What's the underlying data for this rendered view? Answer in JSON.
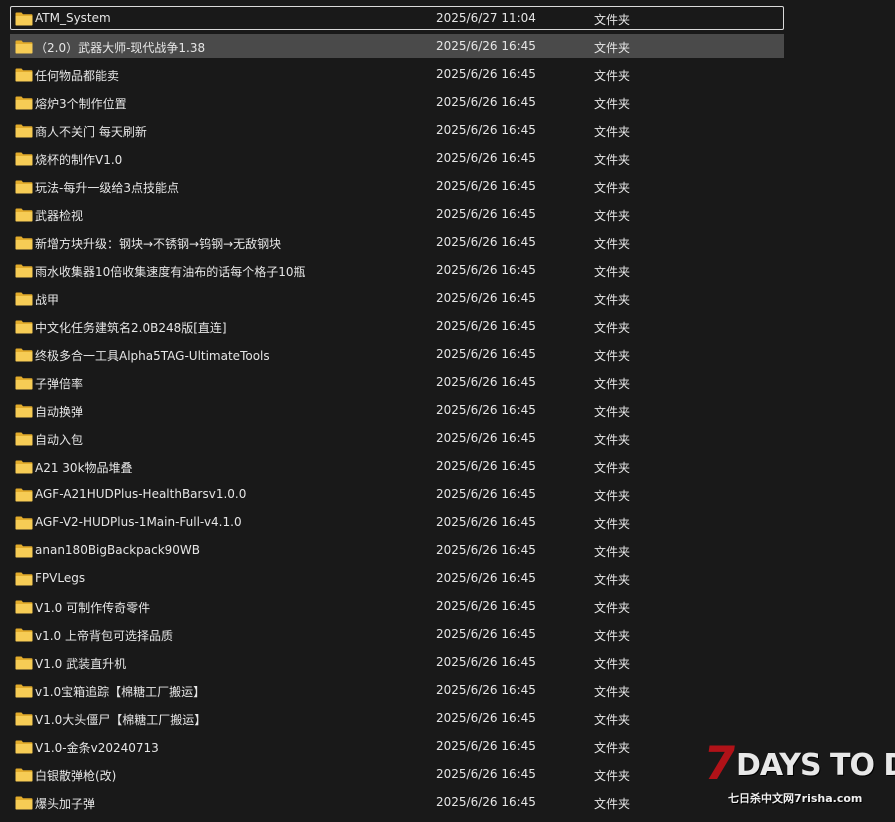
{
  "colors": {
    "background": "#191919",
    "selected_row": "#4a4a4a",
    "folder_yellow": "#f4c64a",
    "watermark_red": "#b01218"
  },
  "files": [
    {
      "name": "ATM_System",
      "date": "2025/6/27 11:04",
      "type": "文件夹",
      "icon": "folder-icon",
      "state": "focused"
    },
    {
      "name": "（2.0）武器大师-现代战争1.38",
      "date": "2025/6/26 16:45",
      "type": "文件夹",
      "icon": "folder-icon",
      "state": "selected"
    },
    {
      "name": "任何物品都能卖",
      "date": "2025/6/26 16:45",
      "type": "文件夹",
      "icon": "folder-icon",
      "state": ""
    },
    {
      "name": "熔炉3个制作位置",
      "date": "2025/6/26 16:45",
      "type": "文件夹",
      "icon": "folder-icon",
      "state": ""
    },
    {
      "name": "商人不关门 每天刷新",
      "date": "2025/6/26 16:45",
      "type": "文件夹",
      "icon": "folder-icon",
      "state": ""
    },
    {
      "name": "烧杯的制作V1.0",
      "date": "2025/6/26 16:45",
      "type": "文件夹",
      "icon": "folder-icon",
      "state": ""
    },
    {
      "name": "玩法-每升一级给3点技能点",
      "date": "2025/6/26 16:45",
      "type": "文件夹",
      "icon": "folder-icon",
      "state": ""
    },
    {
      "name": "武器检视",
      "date": "2025/6/26 16:45",
      "type": "文件夹",
      "icon": "folder-icon",
      "state": ""
    },
    {
      "name": "新增方块升级：钢块→不锈钢→钨钢→无敌钢块",
      "date": "2025/6/26 16:45",
      "type": "文件夹",
      "icon": "folder-icon",
      "state": ""
    },
    {
      "name": "雨水收集器10倍收集速度有油布的话每个格子10瓶",
      "date": "2025/6/26 16:45",
      "type": "文件夹",
      "icon": "folder-icon",
      "state": ""
    },
    {
      "name": "战甲",
      "date": "2025/6/26 16:45",
      "type": "文件夹",
      "icon": "folder-icon",
      "state": ""
    },
    {
      "name": "中文化任务建筑名2.0B248版[直连]",
      "date": "2025/6/26 16:45",
      "type": "文件夹",
      "icon": "folder-icon",
      "state": ""
    },
    {
      "name": "终极多合一工具Alpha5TAG-UltimateTools",
      "date": "2025/6/26 16:45",
      "type": "文件夹",
      "icon": "folder-icon",
      "state": ""
    },
    {
      "name": "子弹倍率",
      "date": "2025/6/26 16:45",
      "type": "文件夹",
      "icon": "folder-icon",
      "state": ""
    },
    {
      "name": "自动换弹",
      "date": "2025/6/26 16:45",
      "type": "文件夹",
      "icon": "folder-icon",
      "state": ""
    },
    {
      "name": "自动入包",
      "date": "2025/6/26 16:45",
      "type": "文件夹",
      "icon": "folder-icon",
      "state": ""
    },
    {
      "name": "A21 30k物品堆叠",
      "date": "2025/6/26 16:45",
      "type": "文件夹",
      "icon": "folder-icon",
      "state": ""
    },
    {
      "name": "AGF-A21HUDPlus-HealthBarsv1.0.0",
      "date": "2025/6/26 16:45",
      "type": "文件夹",
      "icon": "folder-icon",
      "state": ""
    },
    {
      "name": "AGF-V2-HUDPlus-1Main-Full-v4.1.0",
      "date": "2025/6/26 16:45",
      "type": "文件夹",
      "icon": "folder-icon",
      "state": ""
    },
    {
      "name": "anan180BigBackpack90WB",
      "date": "2025/6/26 16:45",
      "type": "文件夹",
      "icon": "folder-icon",
      "state": ""
    },
    {
      "name": "FPVLegs",
      "date": "2025/6/26 16:45",
      "type": "文件夹",
      "icon": "folder-icon",
      "state": ""
    },
    {
      "name": "V1.0 可制作传奇零件",
      "date": "2025/6/26 16:45",
      "type": "文件夹",
      "icon": "folder-icon",
      "state": ""
    },
    {
      "name": "v1.0 上帝背包可选择品质",
      "date": "2025/6/26 16:45",
      "type": "文件夹",
      "icon": "folder-icon",
      "state": ""
    },
    {
      "name": "V1.0 武装直升机",
      "date": "2025/6/26 16:45",
      "type": "文件夹",
      "icon": "folder-icon",
      "state": ""
    },
    {
      "name": "v1.0宝箱追踪【棉糖工厂搬运】",
      "date": "2025/6/26 16:45",
      "type": "文件夹",
      "icon": "folder-icon",
      "state": ""
    },
    {
      "name": "V1.0大头僵尸【棉糖工厂搬运】",
      "date": "2025/6/26 16:45",
      "type": "文件夹",
      "icon": "folder-icon",
      "state": ""
    },
    {
      "name": "V1.0-金条v20240713",
      "date": "2025/6/26 16:45",
      "type": "文件夹",
      "icon": "folder-icon",
      "state": ""
    },
    {
      "name": "白银散弹枪(改)",
      "date": "2025/6/26 16:45",
      "type": "文件夹",
      "icon": "folder-icon",
      "state": ""
    },
    {
      "name": "爆头加子弹",
      "date": "2025/6/26 16:45",
      "type": "文件夹",
      "icon": "folder-icon",
      "state": ""
    }
  ],
  "watermark": {
    "big": "7",
    "main": "DAYS TO DIE",
    "sub": "七日杀中文网7risha.com"
  }
}
